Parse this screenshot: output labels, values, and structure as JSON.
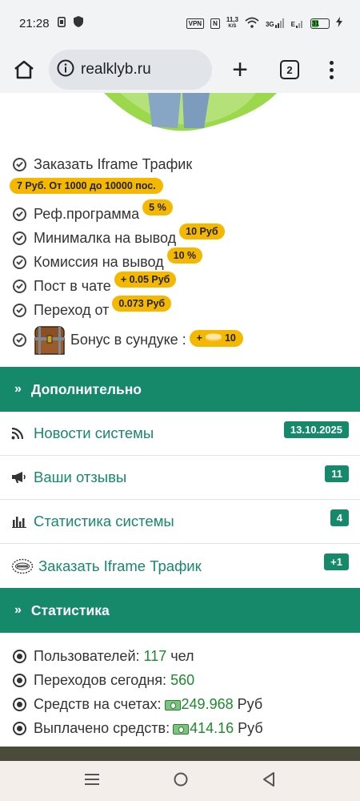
{
  "status_bar": {
    "time": "21:28",
    "vpn_label": "VPN",
    "nfc_label": "N",
    "speed_value": "11,3",
    "speed_unit": "K/S",
    "net_label": "3G",
    "net2_label": "E",
    "battery_level": "31"
  },
  "browser": {
    "url": "realklyb.ru",
    "tab_count": "2"
  },
  "features": [
    {
      "label": "Заказать Iframe Трафик",
      "pill": "7 Руб. От 1000 до 10000 пос."
    },
    {
      "label": "Реф.программа",
      "pill": "5 %"
    },
    {
      "label": "Минималка на вывод",
      "pill": "10 Руб"
    },
    {
      "label": "Комиссия на вывод",
      "pill": "10 %"
    },
    {
      "label": "Пост в чате",
      "pill": "+ 0.05 Руб"
    },
    {
      "label": "Переход от",
      "pill": "0.073 Руб"
    },
    {
      "label": "Бонус в сундуке :",
      "pill_prefix": "+",
      "pill_value": "10"
    }
  ],
  "additional": {
    "heading": "Дополнительно",
    "links": [
      {
        "label": "Новости системы",
        "badge": "13.10.2025",
        "icon": "rss-icon"
      },
      {
        "label": "Ваши отзывы",
        "badge": "11",
        "icon": "megaphone-icon"
      },
      {
        "label": "Статистика системы",
        "badge": "4",
        "icon": "bar-chart-icon"
      },
      {
        "label": "Заказать Iframe Трафик",
        "badge": "+1",
        "icon": "rcl-logo-icon"
      }
    ]
  },
  "statistics": {
    "heading": "Статистика",
    "items": [
      {
        "label": "Пользователей:",
        "value": "117",
        "unit": "чел"
      },
      {
        "label": "Переходов сегодня:",
        "value": "560",
        "unit": ""
      },
      {
        "label": "Средств на счетах:",
        "value": "249.968",
        "unit": "Руб"
      },
      {
        "label": "Выплачено средств:",
        "value": "414.16",
        "unit": "Руб"
      }
    ]
  },
  "colors": {
    "accent": "#16896b",
    "pill": "#f5b800",
    "value_green": "#1c8a2c"
  }
}
